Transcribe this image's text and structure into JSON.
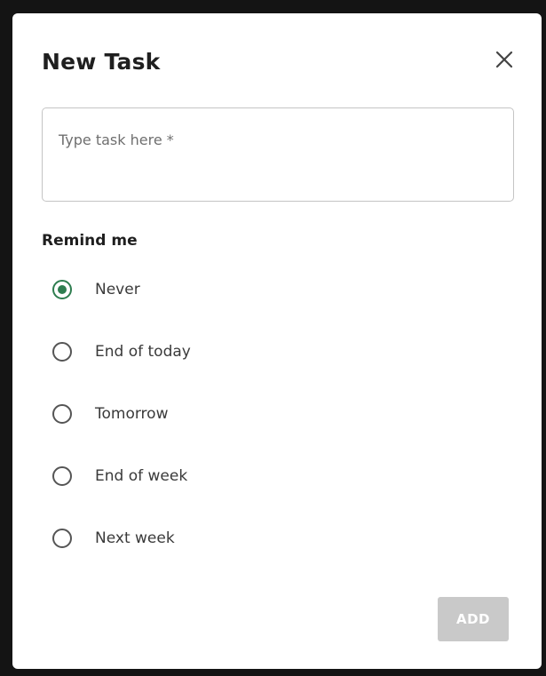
{
  "dialog": {
    "title": "New Task",
    "close_icon": "close-icon"
  },
  "task_input": {
    "placeholder": "Type task here *",
    "value": ""
  },
  "reminder": {
    "label": "Remind me",
    "selected": "Never",
    "accent_color": "#2e7d4f",
    "options": [
      {
        "label": "Never",
        "checked": true
      },
      {
        "label": "End of today",
        "checked": false
      },
      {
        "label": "Tomorrow",
        "checked": false
      },
      {
        "label": "End of week",
        "checked": false
      },
      {
        "label": "Next week",
        "checked": false
      }
    ]
  },
  "actions": {
    "add_label": "ADD",
    "add_disabled": true
  }
}
